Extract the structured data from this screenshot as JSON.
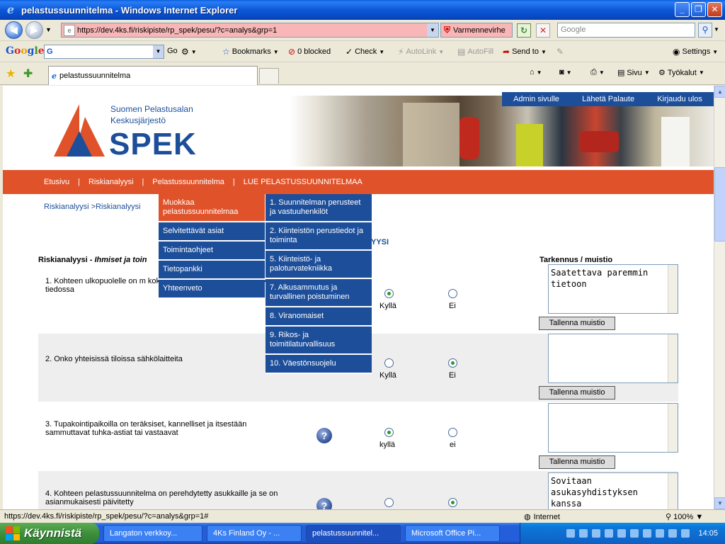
{
  "window": {
    "title": "pelastussuunnitelma - Windows Internet Explorer"
  },
  "address": {
    "url": "https://dev.4ks.fi/riskipiste/rp_spek/pesu/?c=analys&grp=1",
    "cert_error": "Varmennevirhe",
    "search_placeholder": "Google"
  },
  "google_toolbar": {
    "go": "Go",
    "bookmarks": "Bookmarks",
    "blocked": "0 blocked",
    "check": "Check",
    "autolink": "AutoLink",
    "autofill": "AutoFill",
    "send_to": "Send to",
    "settings": "Settings"
  },
  "tabs": {
    "active_title": "pelastussuunnitelma",
    "page_menu": "Sivu",
    "tools_menu": "Työkalut"
  },
  "site": {
    "logo_line1": "Suomen Pelastusalan",
    "logo_line2": "Keskusjärjestö",
    "logo_big": "SPEK",
    "top_links": [
      "Admin sivulle",
      "Lähetä Palaute",
      "Kirjaudu ulos"
    ],
    "nav": [
      "Etusivu",
      "Riskianalyysi",
      "Pelastussuunnitelma",
      "LUE PELASTUSSUUNNITELMAA"
    ],
    "breadcrumb": "Riskianalyysi >Riskianalyysi",
    "yysi_fragment": "YYSI",
    "section_title_a": "Riskianalyysi -",
    "section_title_b": "Ihmiset ja toin",
    "note_header": "Tarkennus / muistio",
    "menu1": [
      "Muokkaa pelastussuunnitelmaa",
      "Selvitettävät asiat",
      "Toimintaohjeet",
      "Tietopankki",
      "Yhteenveto"
    ],
    "menu2": [
      "1. Suunnitelman perusteet ja vastuuhenkilöt",
      "2. Kiinteistön perustiedot ja toiminta",
      "5. Kiinteistö- ja paloturvatekniikka",
      "7. Alkusammutus ja turvallinen poistuminen",
      "8. Viranomaiset",
      "9. Rikos- ja toimitilaturvallisuus",
      "10. Väestönsuojelu"
    ],
    "save_label": "Tallenna muistio",
    "questions": [
      {
        "text": "1. Kohteen ulkopuolelle on m kokoontumisalue pelastautu asukkaiden tiedossa",
        "yes": "Kyllä",
        "no": "Ei",
        "answer": "yes",
        "note": "Saatettava paremmin tietoon"
      },
      {
        "text": "2. Onko yhteisissä tiloissa sähkölaitteita",
        "yes": "Kyllä",
        "no": "Ei",
        "answer": "no",
        "note": ""
      },
      {
        "text": "3. Tupakointipaikoilla on teräksiset, kannelliset ja itsestään sammuttavat tuhka-astiat tai vastaavat",
        "yes": "kyllä",
        "no": "ei",
        "answer": "yes",
        "note": ""
      },
      {
        "text": "4. Kohteen pelastussuunnitelma on perehdytetty asukkaille ja se on asianmukaisesti päivitetty",
        "yes": "",
        "no": "",
        "answer": "no",
        "note": "Sovitaan asukasyhdistyksen kanssa"
      }
    ]
  },
  "status": {
    "url": "https://dev.4ks.fi/riskipiste/rp_spek/pesu/?c=analys&grp=1#",
    "zone": "Internet",
    "zoom": "100%"
  },
  "taskbar": {
    "start": "Käynnistä",
    "items": [
      "Langaton verkkoy...",
      "4Ks Finland Oy - ...",
      "pelastussuunnitel...",
      "Microsoft Office Pi..."
    ],
    "lang": "FI",
    "clock": "14:05"
  }
}
